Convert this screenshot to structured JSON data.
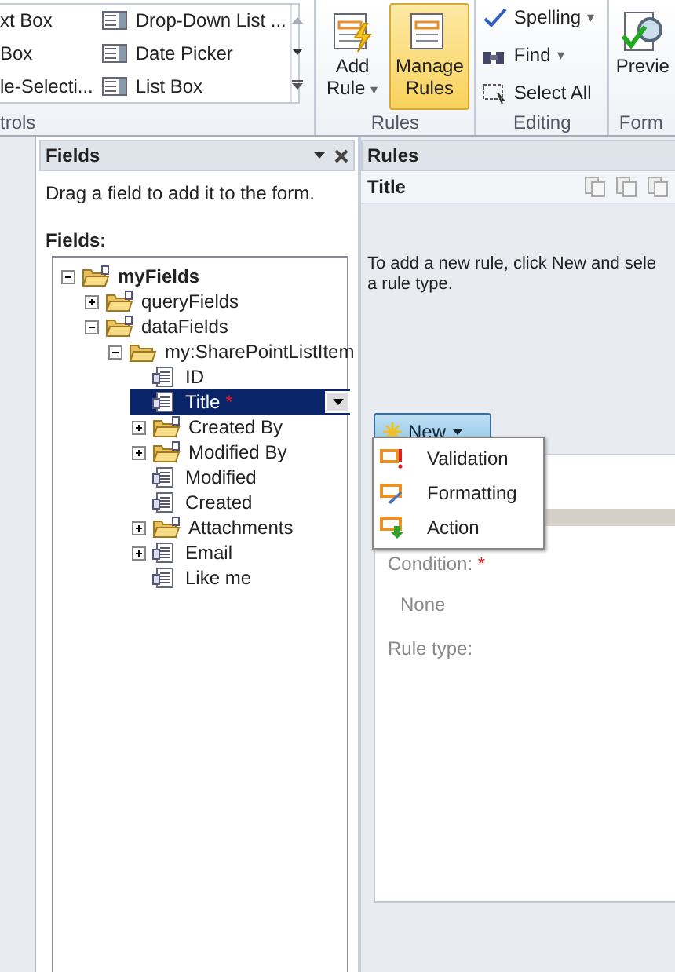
{
  "ribbon": {
    "groups": [
      {
        "kind": "controls",
        "label": "trols",
        "columns": [
          [
            "xt Box",
            "Box",
            "le-Selecti..."
          ],
          [
            "Drop-Down List ...",
            "Date Picker",
            "List Box"
          ]
        ]
      },
      {
        "kind": "big",
        "label": "Rules",
        "buttons": [
          {
            "label": "Add",
            "label2": "Rule",
            "caret": "▾",
            "selected": false
          },
          {
            "label": "Manage",
            "label2": "Rules",
            "selected": true
          }
        ]
      },
      {
        "kind": "small",
        "label": "Editing",
        "buttons": [
          {
            "label": "Spelling",
            "caret": "▾"
          },
          {
            "label": "Find",
            "caret": "▾"
          },
          {
            "label": "Select All"
          }
        ]
      },
      {
        "kind": "preview",
        "label": "Form",
        "buttons": [
          {
            "label": "Previe"
          }
        ]
      }
    ]
  },
  "fields_pane": {
    "title": "Fields",
    "hint": "Drag a field to add it to the form.",
    "tree_label": "Fields:",
    "tree": [
      {
        "label": "myFields",
        "kind": "group",
        "expanded": true,
        "selected": false,
        "children": [
          {
            "label": "queryFields",
            "kind": "group",
            "expanded": false,
            "selected": false
          },
          {
            "label": "dataFields",
            "kind": "group",
            "expanded": true,
            "selected": false,
            "children": [
              {
                "label": "my:SharePointListItem",
                "kind": "folder",
                "expanded": true,
                "selected": false,
                "children": [
                  {
                    "label": "ID",
                    "kind": "field",
                    "selected": false
                  },
                  {
                    "label": "Title",
                    "kind": "field",
                    "selected": true,
                    "required": "*"
                  },
                  {
                    "label": "Created By",
                    "kind": "group",
                    "expanded": false,
                    "selected": false
                  },
                  {
                    "label": "Modified By",
                    "kind": "group",
                    "expanded": false,
                    "selected": false
                  },
                  {
                    "label": "Modified",
                    "kind": "field",
                    "selected": false
                  },
                  {
                    "label": "Created",
                    "kind": "field",
                    "selected": false
                  },
                  {
                    "label": "Attachments",
                    "kind": "group",
                    "expanded": false,
                    "selected": false
                  },
                  {
                    "label": "Email",
                    "kind": "field",
                    "expanded": false,
                    "selected": false
                  },
                  {
                    "label": "Like me",
                    "kind": "field",
                    "selected": false
                  }
                ]
              }
            ]
          }
        ]
      }
    ]
  },
  "rules_pane": {
    "title": "Rules",
    "control": "Title",
    "hint_lines": [
      "To add a new rule, click New and sele",
      "a rule type."
    ],
    "new_button": "New",
    "menu": [
      {
        "label": "Validation",
        "kind": "validation"
      },
      {
        "label": "Formatting",
        "kind": "formatting"
      },
      {
        "label": "Action",
        "kind": "action"
      }
    ],
    "details": {
      "condition_label": "Condition:",
      "condition_mark": "*",
      "condition_value": "None",
      "rule_type_label": "Rule type:"
    }
  }
}
